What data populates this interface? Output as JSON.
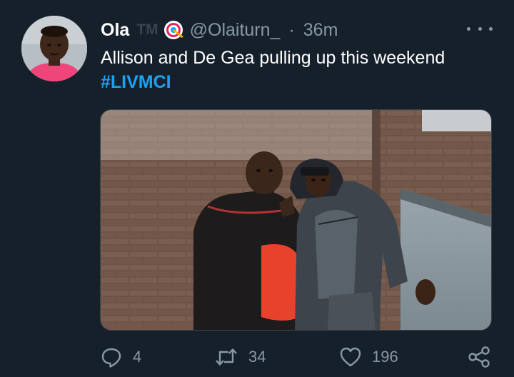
{
  "tweet": {
    "display_name": "Ola",
    "name_suffix": "TM",
    "handle": "@Olaiturn_",
    "separator": "·",
    "time": "36m",
    "text": "Allison and De Gea pulling up this weekend",
    "hashtag": "#LIVMCI",
    "icons": {
      "badge": "target-icon",
      "more": "more-options-icon"
    }
  },
  "actions": {
    "reply_count": "4",
    "retweet_count": "34",
    "like_count": "196"
  },
  "colors": {
    "background": "#15202b",
    "secondary_text": "#8899a6",
    "link": "#1da1f2"
  }
}
